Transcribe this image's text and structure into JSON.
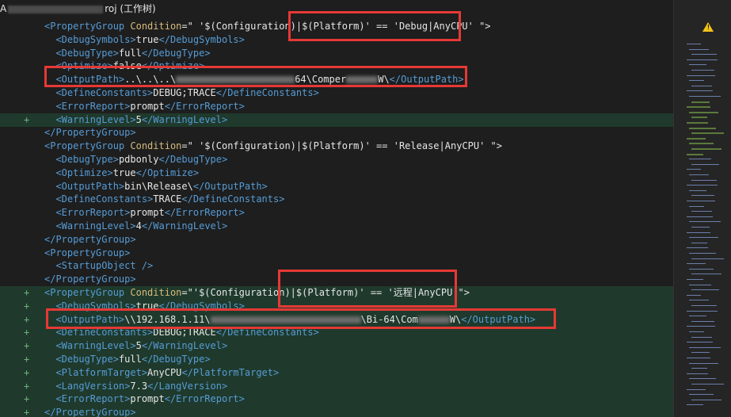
{
  "window": {
    "title_prefix": "A",
    "title_suffix": "roj (工作树)"
  },
  "gutter_marker": "+",
  "warning_icon": "warning-icon",
  "lines": [
    {
      "added": false,
      "indent": 0,
      "parts": [
        [
          "tag",
          "<PropertyGroup "
        ],
        [
          "attr",
          "Condition"
        ],
        [
          "txt",
          "=\" '$(Configuration)|$(Platform)' == 'Debug|AnyCPU' \">"
        ]
      ]
    },
    {
      "added": false,
      "indent": 1,
      "parts": [
        [
          "tag",
          "<DebugSymbols>"
        ],
        [
          "txt",
          "true"
        ],
        [
          "tag",
          "</DebugSymbols>"
        ]
      ]
    },
    {
      "added": false,
      "indent": 1,
      "parts": [
        [
          "tag",
          "<DebugType>"
        ],
        [
          "txt",
          "full"
        ],
        [
          "tag",
          "</DebugType>"
        ]
      ]
    },
    {
      "added": false,
      "indent": 1,
      "parts": [
        [
          "tag",
          "<Optimize>"
        ],
        [
          "txt",
          "false"
        ],
        [
          "tag",
          "</Optimize>"
        ]
      ]
    },
    {
      "added": false,
      "indent": 1,
      "parts": [
        [
          "tag",
          "<OutputPath>"
        ],
        [
          "txt",
          "..\\..\\..\\"
        ],
        [
          "blur",
          "150"
        ],
        [
          "txt",
          "64\\Comper"
        ],
        [
          "blur",
          "40"
        ],
        [
          "txt",
          "W\\"
        ],
        [
          "tag",
          "</OutputPath>"
        ]
      ]
    },
    {
      "added": false,
      "indent": 1,
      "parts": [
        [
          "tag",
          "<DefineConstants>"
        ],
        [
          "txt",
          "DEBUG;TRACE"
        ],
        [
          "tag",
          "</DefineConstants>"
        ]
      ]
    },
    {
      "added": false,
      "indent": 1,
      "parts": [
        [
          "tag",
          "<ErrorReport>"
        ],
        [
          "txt",
          "prompt"
        ],
        [
          "tag",
          "</ErrorReport>"
        ]
      ]
    },
    {
      "added": true,
      "indent": 1,
      "parts": [
        [
          "tag",
          "<WarningLevel>"
        ],
        [
          "txt",
          "5"
        ],
        [
          "tag",
          "</WarningLevel>"
        ]
      ]
    },
    {
      "added": false,
      "indent": 0,
      "parts": [
        [
          "tag",
          "</PropertyGroup>"
        ]
      ]
    },
    {
      "added": false,
      "indent": 0,
      "parts": [
        [
          "tag",
          "<PropertyGroup "
        ],
        [
          "attr",
          "Condition"
        ],
        [
          "txt",
          "=\" '$(Configuration)|$(Platform)' == 'Release|AnyCPU' \">"
        ]
      ]
    },
    {
      "added": false,
      "indent": 1,
      "parts": [
        [
          "tag",
          "<DebugType>"
        ],
        [
          "txt",
          "pdbonly"
        ],
        [
          "tag",
          "</DebugType>"
        ]
      ]
    },
    {
      "added": false,
      "indent": 1,
      "parts": [
        [
          "tag",
          "<Optimize>"
        ],
        [
          "txt",
          "true"
        ],
        [
          "tag",
          "</Optimize>"
        ]
      ]
    },
    {
      "added": false,
      "indent": 1,
      "parts": [
        [
          "tag",
          "<OutputPath>"
        ],
        [
          "txt",
          "bin\\Release\\"
        ],
        [
          "tag",
          "</OutputPath>"
        ]
      ]
    },
    {
      "added": false,
      "indent": 1,
      "parts": [
        [
          "tag",
          "<DefineConstants>"
        ],
        [
          "txt",
          "TRACE"
        ],
        [
          "tag",
          "</DefineConstants>"
        ]
      ]
    },
    {
      "added": false,
      "indent": 1,
      "parts": [
        [
          "tag",
          "<ErrorReport>"
        ],
        [
          "txt",
          "prompt"
        ],
        [
          "tag",
          "</ErrorReport>"
        ]
      ]
    },
    {
      "added": false,
      "indent": 1,
      "parts": [
        [
          "tag",
          "<WarningLevel>"
        ],
        [
          "txt",
          "4"
        ],
        [
          "tag",
          "</WarningLevel>"
        ]
      ]
    },
    {
      "added": false,
      "indent": 0,
      "parts": [
        [
          "tag",
          "</PropertyGroup>"
        ]
      ]
    },
    {
      "added": false,
      "indent": 0,
      "parts": [
        [
          "tag",
          "<PropertyGroup>"
        ]
      ]
    },
    {
      "added": false,
      "indent": 1,
      "parts": [
        [
          "tag",
          "<StartupObject />"
        ]
      ]
    },
    {
      "added": false,
      "indent": 0,
      "parts": [
        [
          "tag",
          "</PropertyGroup>"
        ]
      ]
    },
    {
      "added": true,
      "indent": 0,
      "parts": [
        [
          "tag",
          "<PropertyGroup "
        ],
        [
          "attr",
          "Condition"
        ],
        [
          "txt",
          "=\"'$(Configuration)|$(Platform)' == '远程|AnyCPU'\">"
        ]
      ]
    },
    {
      "added": true,
      "indent": 1,
      "parts": [
        [
          "tag",
          "<DebugSymbols>"
        ],
        [
          "txt",
          "true"
        ],
        [
          "tag",
          "</DebugSymbols>"
        ]
      ]
    },
    {
      "added": true,
      "indent": 1,
      "parts": [
        [
          "tag",
          "<OutputPath>"
        ],
        [
          "txt",
          "\\\\192.168.1.11\\"
        ],
        [
          "blur",
          "190"
        ],
        [
          "txt",
          "\\Bi-64\\Com"
        ],
        [
          "blur",
          "40"
        ],
        [
          "txt",
          "W\\"
        ],
        [
          "tag",
          "</OutputPath>"
        ]
      ]
    },
    {
      "added": true,
      "indent": 1,
      "parts": [
        [
          "tag",
          "<DefineConstants>"
        ],
        [
          "txt",
          "DEBUG;TRACE"
        ],
        [
          "tag",
          "</DefineConstants>"
        ]
      ]
    },
    {
      "added": true,
      "indent": 1,
      "parts": [
        [
          "tag",
          "<WarningLevel>"
        ],
        [
          "txt",
          "5"
        ],
        [
          "tag",
          "</WarningLevel>"
        ]
      ]
    },
    {
      "added": true,
      "indent": 1,
      "parts": [
        [
          "tag",
          "<DebugType>"
        ],
        [
          "txt",
          "full"
        ],
        [
          "tag",
          "</DebugType>"
        ]
      ]
    },
    {
      "added": true,
      "indent": 1,
      "parts": [
        [
          "tag",
          "<PlatformTarget>"
        ],
        [
          "txt",
          "AnyCPU"
        ],
        [
          "tag",
          "</PlatformTarget>"
        ]
      ]
    },
    {
      "added": true,
      "indent": 1,
      "parts": [
        [
          "tag",
          "<LangVersion>"
        ],
        [
          "txt",
          "7.3"
        ],
        [
          "tag",
          "</LangVersion>"
        ]
      ]
    },
    {
      "added": true,
      "indent": 1,
      "parts": [
        [
          "tag",
          "<ErrorReport>"
        ],
        [
          "txt",
          "prompt"
        ],
        [
          "tag",
          "</ErrorReport>"
        ]
      ]
    },
    {
      "added": true,
      "indent": 0,
      "parts": [
        [
          "tag",
          "</PropertyGroup>"
        ]
      ]
    }
  ]
}
